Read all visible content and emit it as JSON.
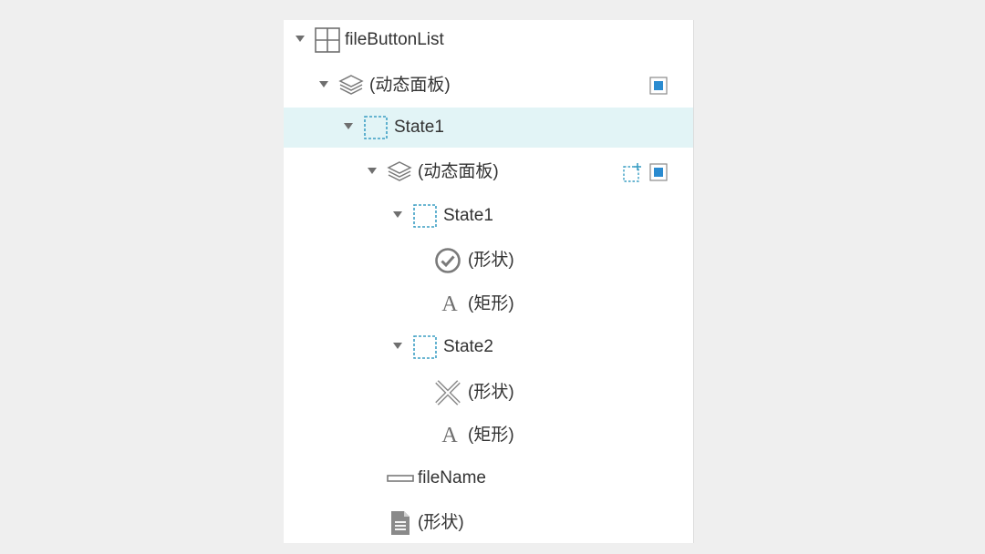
{
  "tree": {
    "items": [
      {
        "label": "fileButtonList",
        "icon": "grid-icon"
      },
      {
        "label": "(动态面板)",
        "icon": "layers-icon"
      },
      {
        "label": "State1",
        "icon": "state-icon"
      },
      {
        "label": "(动态面板)",
        "icon": "layers-icon"
      },
      {
        "label": "State1",
        "icon": "state-icon"
      },
      {
        "label": "(形状)",
        "icon": "check-circle-icon"
      },
      {
        "label": "(矩形)",
        "icon": "text-icon",
        "glyph": "A"
      },
      {
        "label": "State2",
        "icon": "state-icon"
      },
      {
        "label": "(形状)",
        "icon": "close-x-icon"
      },
      {
        "label": "(矩形)",
        "icon": "text-icon",
        "glyph": "A"
      },
      {
        "label": "fileName",
        "icon": "text-field-icon"
      },
      {
        "label": "(形状)",
        "icon": "document-icon"
      }
    ],
    "selected_index": 2
  },
  "colors": {
    "accent": "#2a8bd0",
    "selected_bg": "#e2f4f6",
    "icon_gray": "#6f6f6f",
    "state_dash": "#3d9fc4"
  }
}
